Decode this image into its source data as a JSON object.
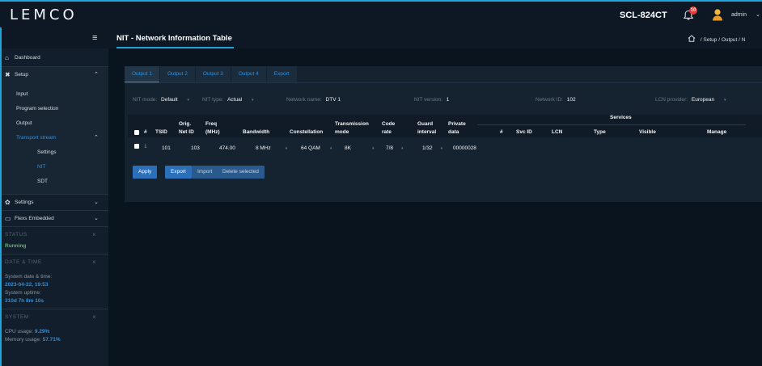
{
  "app": {
    "logo": "LEMCO",
    "device": "SCL-824CT",
    "notifications": "10",
    "user": "admin"
  },
  "page": {
    "title": "NIT - Network Information Table",
    "breadcrumb": "/ Setup / Output / N"
  },
  "sidebar": {
    "dashboard": "Dashboard",
    "setup": "Setup",
    "input": "Input",
    "program_selection": "Program selection",
    "output": "Output",
    "transport_stream": "Transport stream",
    "ts_settings": "Settings",
    "nit": "NIT",
    "sdt": "SDT",
    "settings": "Settings",
    "flexs": "Flexs Embedded",
    "status_header": "STATUS",
    "status_value": "Running",
    "datetime_header": "DATE & TIME",
    "system_date_label": "System date & time:",
    "system_date_value": "2023-04-22, 19:53",
    "uptime_label": "System uptime:",
    "uptime_value": "310d 7h 8m 10s",
    "system_header": "SYSTEM",
    "cpu_label": "CPU usage:",
    "cpu_value": "9.29%",
    "memory_label": "Memory usage:",
    "memory_value": "57.71%"
  },
  "tabs": [
    "Output 1",
    "Output 2",
    "Output 3",
    "Output 4",
    "Export"
  ],
  "fields": {
    "nit_mode_label": "NIT mode:",
    "nit_mode_value": "Default",
    "nit_type_label": "NIT type:",
    "nit_type_value": "Actual",
    "network_name_label": "Network name:",
    "network_name_value": "DTV 1",
    "nit_version_label": "NIT version:",
    "nit_version_value": "1",
    "network_id_label": "Network ID:",
    "network_id_value": "102",
    "lcn_provider_label": "LCN provider:",
    "lcn_provider_value": "European"
  },
  "table": {
    "headers": {
      "num": "#",
      "tsid": "TSID",
      "orig1": "Orig.",
      "orig2": "Net ID",
      "freq1": "Freq",
      "freq2": "(MHz)",
      "bandwidth": "Bandwidth",
      "constellation": "Constellation",
      "tm1": "Transmission",
      "tm2": "mode",
      "cr1": "Code",
      "cr2": "rate",
      "gi1": "Guard",
      "gi2": "interval",
      "pd1": "Private",
      "pd2": "data",
      "services": "Services",
      "svc_num": "#",
      "svc_id": "Svc ID",
      "lcn": "LCN",
      "type": "Type",
      "visible": "Visible",
      "manage": "Manage"
    },
    "row": {
      "num": "1",
      "tsid": "101",
      "orig_net_id": "103",
      "freq": "474.00",
      "bandwidth": "8 MHz",
      "constellation": "64 QAM",
      "mode": "8K",
      "code_rate": "7/8",
      "guard": "1/32",
      "private_data": "00000028"
    }
  },
  "buttons": {
    "apply": "Apply",
    "export": "Export",
    "import": "Import",
    "delete_selected": "Delete selected"
  }
}
